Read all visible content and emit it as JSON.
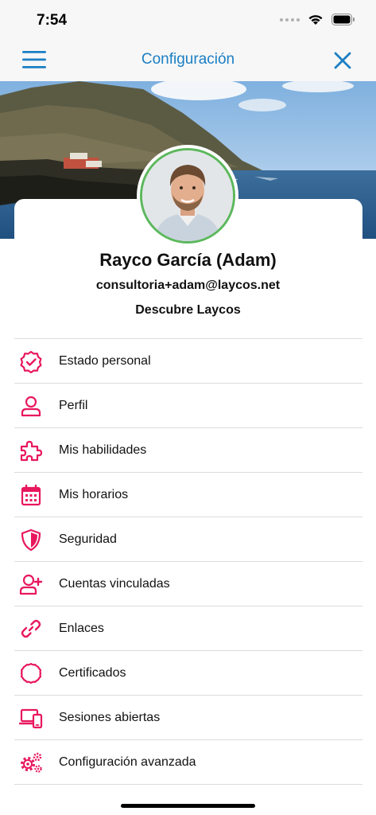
{
  "status_bar": {
    "time": "7:54"
  },
  "nav": {
    "title": "Configuración",
    "menu_icon": "hamburger-menu-icon",
    "close_icon": "close-icon"
  },
  "profile": {
    "name": "Rayco García (Adam)",
    "email": "consultoria+adam@laycos.net",
    "organization": "Descubre Laycos"
  },
  "colors": {
    "accent": "#1b7fc4",
    "icon": "#e8175d",
    "avatar_ring": "#5cb85c"
  },
  "menu": [
    {
      "label": "Estado personal",
      "icon": "badge-check-icon"
    },
    {
      "label": "Perfil",
      "icon": "user-icon"
    },
    {
      "label": "Mis habilidades",
      "icon": "puzzle-icon"
    },
    {
      "label": "Mis horarios",
      "icon": "calendar-icon"
    },
    {
      "label": "Seguridad",
      "icon": "shield-icon"
    },
    {
      "label": "Cuentas vinculadas",
      "icon": "user-plus-icon"
    },
    {
      "label": "Enlaces",
      "icon": "link-icon"
    },
    {
      "label": "Certificados",
      "icon": "certificate-icon"
    },
    {
      "label": "Sesiones abiertas",
      "icon": "devices-icon"
    },
    {
      "label": "Configuración avanzada",
      "icon": "gears-icon"
    }
  ]
}
